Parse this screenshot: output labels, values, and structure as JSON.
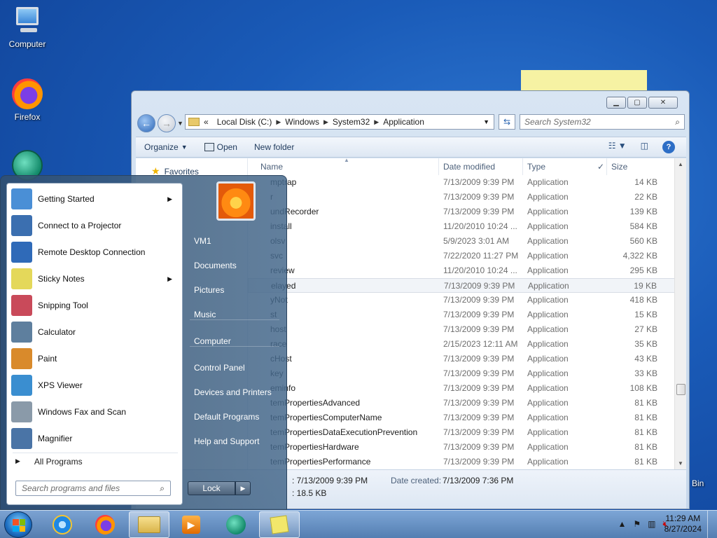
{
  "desktop": {
    "icons": [
      {
        "label": "Computer"
      },
      {
        "label": "Firefox"
      }
    ],
    "bin_label": "Bin"
  },
  "explorer": {
    "address": {
      "prefix": "«",
      "crumbs": [
        "Local Disk (C:)",
        "Windows",
        "System32",
        "Application"
      ]
    },
    "search_placeholder": "Search System32",
    "toolbar": {
      "organize": "Organize",
      "open": "Open",
      "new_folder": "New folder"
    },
    "nav": {
      "favorites": "Favorites"
    },
    "columns": {
      "name": "Name",
      "date": "Date modified",
      "type": "Type",
      "size": "Size"
    },
    "files": [
      {
        "name": "mptrap",
        "date": "7/13/2009 9:39 PM",
        "type": "Application",
        "size": "14 KB"
      },
      {
        "name": "r",
        "date": "7/13/2009 9:39 PM",
        "type": "Application",
        "size": "22 KB"
      },
      {
        "name": "undRecorder",
        "date": "7/13/2009 9:39 PM",
        "type": "Application",
        "size": "139 KB"
      },
      {
        "name": "install",
        "date": "11/20/2010 10:24 ...",
        "type": "Application",
        "size": "584 KB"
      },
      {
        "name": "olsv",
        "date": "5/9/2023 3:01 AM",
        "type": "Application",
        "size": "560 KB"
      },
      {
        "name": "svc",
        "date": "7/22/2020 11:27 PM",
        "type": "Application",
        "size": "4,322 KB"
      },
      {
        "name": "review",
        "date": "11/20/2010 10:24 ...",
        "type": "Application",
        "size": "295 KB"
      },
      {
        "name": "elayed",
        "date": "7/13/2009 9:39 PM",
        "type": "Application",
        "size": "19 KB"
      },
      {
        "name": "yNot",
        "date": "7/13/2009 9:39 PM",
        "type": "Application",
        "size": "418 KB"
      },
      {
        "name": "st",
        "date": "7/13/2009 9:39 PM",
        "type": "Application",
        "size": "15 KB"
      },
      {
        "name": "host",
        "date": "7/13/2009 9:39 PM",
        "type": "Application",
        "size": "27 KB"
      },
      {
        "name": "race",
        "date": "2/15/2023 12:11 AM",
        "type": "Application",
        "size": "35 KB"
      },
      {
        "name": "cHost",
        "date": "7/13/2009 9:39 PM",
        "type": "Application",
        "size": "43 KB"
      },
      {
        "name": "key",
        "date": "7/13/2009 9:39 PM",
        "type": "Application",
        "size": "33 KB"
      },
      {
        "name": "eminfo",
        "date": "7/13/2009 9:39 PM",
        "type": "Application",
        "size": "108 KB"
      },
      {
        "name": "temPropertiesAdvanced",
        "date": "7/13/2009 9:39 PM",
        "type": "Application",
        "size": "81 KB"
      },
      {
        "name": "temPropertiesComputerName",
        "date": "7/13/2009 9:39 PM",
        "type": "Application",
        "size": "81 KB"
      },
      {
        "name": "temPropertiesDataExecutionPrevention",
        "date": "7/13/2009 9:39 PM",
        "type": "Application",
        "size": "81 KB"
      },
      {
        "name": "temPropertiesHardware",
        "date": "7/13/2009 9:39 PM",
        "type": "Application",
        "size": "81 KB"
      },
      {
        "name": "temPropertiesPerformance",
        "date": "7/13/2009 9:39 PM",
        "type": "Application",
        "size": "81 KB"
      }
    ],
    "details": {
      "modified_value": ": 7/13/2009 9:39 PM",
      "created_label": "Date created:",
      "created_value": "7/13/2009 7:36 PM",
      "size_value": ": 18.5 KB"
    }
  },
  "start_menu": {
    "programs": [
      {
        "label": "Getting Started",
        "submenu": true,
        "color": "#4a8fd6"
      },
      {
        "label": "Connect to a Projector",
        "submenu": false,
        "color": "#3b6fb0"
      },
      {
        "label": "Remote Desktop Connection",
        "submenu": false,
        "color": "#2f6ab8"
      },
      {
        "label": "Sticky Notes",
        "submenu": true,
        "color": "#e4d85a"
      },
      {
        "label": "Snipping Tool",
        "submenu": false,
        "color": "#c94a5a"
      },
      {
        "label": "Calculator",
        "submenu": false,
        "color": "#5e7f9e"
      },
      {
        "label": "Paint",
        "submenu": false,
        "color": "#d98a2b"
      },
      {
        "label": "XPS Viewer",
        "submenu": false,
        "color": "#3a8ed0"
      },
      {
        "label": "Windows Fax and Scan",
        "submenu": false,
        "color": "#8a9aa9"
      },
      {
        "label": "Magnifier",
        "submenu": false,
        "color": "#4a74a6"
      }
    ],
    "all_programs": "All Programs",
    "search_placeholder": "Search programs and files",
    "right_items": [
      "VM1",
      "Documents",
      "Pictures",
      "Music",
      "Computer",
      "Control Panel",
      "Devices and Printers",
      "Default Programs",
      "Help and Support"
    ],
    "lock": "Lock"
  },
  "taskbar": {
    "time": "11:29 AM",
    "date": "8/27/2024"
  }
}
